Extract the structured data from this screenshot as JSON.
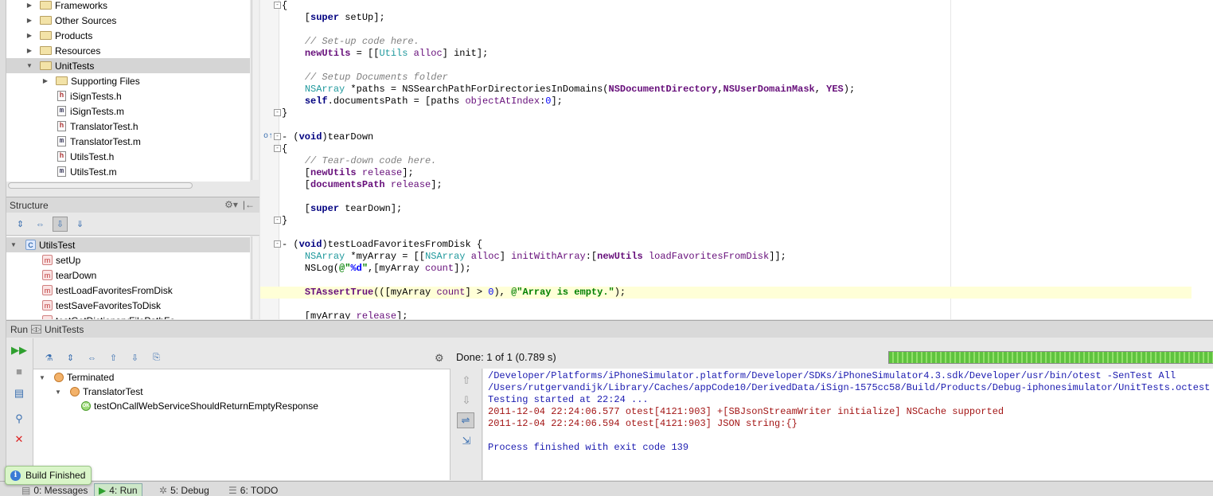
{
  "project_tree": {
    "items": [
      {
        "label": "Frameworks",
        "type": "folder",
        "expanded": false
      },
      {
        "label": "Other Sources",
        "type": "folder",
        "expanded": false
      },
      {
        "label": "Products",
        "type": "folder",
        "expanded": false
      },
      {
        "label": "Resources",
        "type": "folder",
        "expanded": false
      },
      {
        "label": "UnitTests",
        "type": "folder",
        "expanded": true,
        "selected": true
      },
      {
        "label": "Supporting Files",
        "type": "folder",
        "expanded": false
      },
      {
        "label": "iSignTests.h",
        "type": "h"
      },
      {
        "label": "iSignTests.m",
        "type": "m"
      },
      {
        "label": "TranslatorTest.h",
        "type": "h"
      },
      {
        "label": "TranslatorTest.m",
        "type": "m"
      },
      {
        "label": "UtilsTest.h",
        "type": "h"
      },
      {
        "label": "UtilsTest.m",
        "type": "m"
      }
    ]
  },
  "structure": {
    "title": "Structure",
    "class_icon_letter": "C",
    "method_icon_letter": "m",
    "items": [
      {
        "label": "UtilsTest",
        "kind": "class",
        "selected": true
      },
      {
        "label": "setUp",
        "kind": "method"
      },
      {
        "label": "tearDown",
        "kind": "method"
      },
      {
        "label": "testLoadFavoritesFromDisk",
        "kind": "method"
      },
      {
        "label": "testSaveFavoritesToDisk",
        "kind": "method"
      },
      {
        "label": "testGetDictionaryFilePathFo",
        "kind": "method"
      }
    ]
  },
  "run": {
    "header_label": "Run",
    "config_name": "UnitTests",
    "status_text": "Done: 1 of 1  (0.789 s)",
    "progress": 1.0,
    "tests": [
      {
        "label": "Terminated",
        "status": "terminated",
        "level": 0
      },
      {
        "label": "TranslatorTest",
        "status": "terminated",
        "level": 1
      },
      {
        "label": "testOnCallWebServiceShouldReturnEmptyResponse",
        "status": "passed",
        "level": 2
      }
    ],
    "pass_icon_text": "OK",
    "console": [
      {
        "text": "/Developer/Platforms/iPhoneSimulator.platform/Developer/SDKs/iPhoneSimulator4.3.sdk/Developer/usr/bin/otest -SenTest All",
        "kind": "blue"
      },
      {
        "text": "/Users/rutgervandijk/Library/Caches/appCode10/DerivedData/iSign-1575cc58/Build/Products/Debug-iphonesimulator/UnitTests.octest",
        "kind": "blue"
      },
      {
        "text": "Testing started at 22:24 ...",
        "kind": "blue"
      },
      {
        "text": "2011-12-04 22:24:06.577 otest[4121:903] +[SBJsonStreamWriter initialize] NSCache supported",
        "kind": "red"
      },
      {
        "text": "2011-12-04 22:24:06.594 otest[4121:903] JSON string:{}",
        "kind": "red"
      },
      {
        "text": "",
        "kind": "blue"
      },
      {
        "text": "Process finished with exit code 139",
        "kind": "blue"
      }
    ]
  },
  "bottom_tabs": [
    {
      "label": "0: Messages",
      "icon": "messages-icon"
    },
    {
      "label": "4: Run",
      "icon": "run-icon",
      "active": true
    },
    {
      "label": "5: Debug",
      "icon": "debug-icon"
    },
    {
      "label": "6: TODO",
      "icon": "todo-icon"
    }
  ],
  "tooltip": {
    "text": "Build Finished",
    "info_glyph": "i"
  },
  "colors": {
    "progress_green": "#5fc33f",
    "highlight_line": "#ffffd7",
    "keyword": "#000080",
    "comment": "#808080",
    "string": "#008000",
    "console_error": "#a31515",
    "console_normal": "#1b1bb0"
  }
}
